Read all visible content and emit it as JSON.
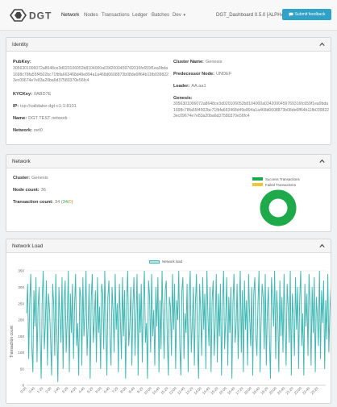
{
  "nav": {
    "brand": "DGT",
    "links": [
      "Network",
      "Nodes",
      "Transactions",
      "Ledger",
      "Batches",
      "Dev"
    ],
    "app_name": "DGT_Dashboard 0.5.0 [ALPHA]",
    "submit_label": "Submit feedback"
  },
  "identity": {
    "title": "Identity",
    "pubkey_label": "PubKey:",
    "pubkey": "3056301006072a8648ce3d020106052b8104000a0342000459769316fc659f1ea9bda1698c78fa55f4502bc71fbfa663468d49e894a1a468d0608873b08de6ff64b11fb0398223ec09674e7e83a20ba6d37580370e56fc4",
    "kyckey_label": "KYCKey:",
    "kyckey": "0ABD7E",
    "ip_label": "IP:",
    "ip": "tcp://validator-dgt-c1-1:8101",
    "name_label": "Name:",
    "name": "DGT TEST network",
    "network_label": "Network:",
    "network": "net0",
    "cluster_label": "Cluster Name:",
    "cluster": "Genesis",
    "predecessor_label": "Predecessor Node:",
    "predecessor": "UNDEF",
    "leader_label": "Leader:",
    "leader": "AA.aa1",
    "genesis_label": "Genesis:",
    "genesis": "3056301006072a8648ce3d020106052b8104000a0342000459769316fc659f1ea9bda1698c78fa55f4502bc71fbfa663468d49e894a1a468d0608873b08de6ff64b11fb0398223ec09674e7e83a20ba6d37580370e56fc4"
  },
  "network": {
    "title": "Network",
    "cluster_label": "Cluster:",
    "cluster": "Genesis",
    "node_count_label": "Node count:",
    "node_count": "36",
    "tx_count_label": "Transaction count:",
    "tx_count": "34",
    "tx_count_sub": "34",
    "tx_count_sep": "/",
    "tx_count_sub2": "0",
    "legend_success": "Success Transactions",
    "legend_failed": "Failed Transactions",
    "colors": {
      "success": "#1eaa4a",
      "failed": "#f2c438"
    },
    "donut": {
      "success": 34,
      "failed": 0
    }
  },
  "load": {
    "title": "Network Load",
    "legend": "Network load",
    "ylabel": "Transaction count",
    "line_color": "#41b8b3"
  },
  "chart_data": {
    "type": "line",
    "title": "",
    "xlabel": "",
    "ylabel": "Transaction count",
    "ylim": [
      0,
      350
    ],
    "yticks": [
      0,
      50,
      100,
      150,
      200,
      250,
      300,
      350
    ],
    "x": [
      "0:00",
      "0:05",
      "0:10",
      "0:15",
      "0:20",
      "0:25",
      "0:30",
      "0:35",
      "0:40",
      "0:45",
      "0:50",
      "0:55",
      "1:00",
      "1:05",
      "1:10",
      "1:15",
      "1:20",
      "1:25",
      "1:30",
      "1:35",
      "1:40",
      "1:45",
      "1:50",
      "1:55",
      "2:00",
      "2:05",
      "2:10",
      "2:15",
      "2:20",
      "2:25",
      "2:30",
      "2:35",
      "2:40",
      "2:45",
      "2:50",
      "2:55",
      "3:00",
      "3:05",
      "3:10",
      "3:15",
      "3:20",
      "3:25",
      "3:30",
      "3:35",
      "3:40",
      "3:45",
      "3:50",
      "3:55",
      "4:00",
      "4:05",
      "4:10",
      "4:15",
      "4:20",
      "4:25",
      "4:30",
      "4:35",
      "4:40",
      "4:45",
      "4:50",
      "4:55",
      "5:00",
      "5:05",
      "5:10",
      "5:15",
      "5:20",
      "5:25",
      "5:30",
      "5:35",
      "5:40",
      "5:45",
      "5:50",
      "5:55",
      "6:00",
      "6:05",
      "6:10",
      "6:15",
      "6:20",
      "6:25",
      "6:30",
      "6:35",
      "6:40",
      "6:45",
      "6:50",
      "6:55",
      "7:00",
      "7:05",
      "7:10",
      "7:15",
      "7:20",
      "7:25",
      "7:30",
      "7:35",
      "7:40",
      "7:45",
      "7:50",
      "7:55",
      "8:00",
      "8:05",
      "8:10",
      "8:15",
      "8:20",
      "8:25",
      "8:30",
      "8:35",
      "8:40",
      "8:45",
      "8:50",
      "8:55",
      "9:00",
      "9:05",
      "9:10",
      "9:15",
      "9:20",
      "9:25",
      "9:30",
      "9:35",
      "9:40",
      "9:45",
      "9:50",
      "9:55",
      "10:00",
      "10:05",
      "10:10",
      "10:15",
      "10:20",
      "10:25",
      "10:30",
      "10:35",
      "10:40",
      "10:45",
      "10:50",
      "10:55",
      "11:00",
      "11:05",
      "11:10",
      "11:15",
      "11:20",
      "11:25",
      "11:30",
      "11:35",
      "11:40",
      "11:45",
      "11:50",
      "11:55",
      "12:00",
      "12:05",
      "12:10",
      "12:15",
      "12:20",
      "12:25",
      "12:30",
      "12:35",
      "12:40",
      "12:45",
      "12:50",
      "12:55",
      "13:00",
      "13:05",
      "13:10",
      "13:15",
      "13:20",
      "13:25",
      "13:30",
      "13:35",
      "13:40",
      "13:45",
      "13:50",
      "13:55",
      "14:00",
      "14:05",
      "14:10",
      "14:15",
      "14:20",
      "14:25",
      "14:30",
      "14:35",
      "14:40",
      "14:45",
      "14:50",
      "14:55",
      "15:00",
      "15:05",
      "15:10",
      "15:15",
      "15:20",
      "15:25",
      "15:30",
      "15:35",
      "15:40",
      "15:45",
      "15:50",
      "15:55",
      "16:00",
      "16:05",
      "16:10",
      "16:15",
      "16:20",
      "16:25",
      "16:30",
      "16:35",
      "16:40",
      "16:45",
      "16:50",
      "16:55",
      "17:00",
      "17:05",
      "17:10",
      "17:15",
      "17:20",
      "17:25",
      "17:30",
      "17:35",
      "17:40",
      "17:45",
      "17:50",
      "17:55",
      "18:00",
      "18:05",
      "18:10",
      "18:15",
      "18:20",
      "18:25",
      "18:30",
      "18:35",
      "18:40",
      "18:45",
      "18:50",
      "18:55",
      "19:00",
      "19:05",
      "19:10",
      "19:15",
      "19:20",
      "19:25",
      "19:30",
      "19:35",
      "19:40",
      "19:45",
      "19:50",
      "19:55",
      "20:00",
      "20:05",
      "20:10",
      "20:15",
      "20:20",
      "20:25",
      "20:30",
      "20:35",
      "20:40",
      "20:45",
      "20:50",
      "20:55",
      "21:00",
      "21:05",
      "21:10",
      "21:15",
      "21:20",
      "21:25",
      "21:30",
      "21:35",
      "21:40",
      "21:45",
      "21:50",
      "21:55",
      "22:00",
      "22:05",
      "22:10",
      "22:15",
      "22:20",
      "22:25",
      "22:30",
      "22:35",
      "22:40",
      "22:45",
      "22:50",
      "22:55",
      "23:00",
      "23:05",
      "23:10",
      "23:15",
      "23:20",
      "23:25",
      "23:30",
      "23:35",
      "23:40",
      "23:45",
      "23:50",
      "23:55"
    ],
    "xticks": [
      "0:00",
      "0:40",
      "1:20",
      "2:00",
      "2:40",
      "3:20",
      "4:00",
      "4:40",
      "5:20",
      "6:00",
      "6:40",
      "7:20",
      "8:00",
      "8:40",
      "9:20",
      "10:00",
      "10:40",
      "11:20",
      "12:00",
      "12:40",
      "13:20",
      "14:00",
      "14:40",
      "15:20",
      "16:00",
      "16:40",
      "17:20",
      "18:00",
      "18:40",
      "19:20",
      "20:00",
      "20:40",
      "21:20",
      "22:00",
      "22:40",
      "23:20"
    ],
    "series": [
      {
        "name": "Network load",
        "values": [
          220,
          310,
          80,
          260,
          340,
          120,
          40,
          290,
          180,
          330,
          70,
          240,
          300,
          150,
          20,
          270,
          350,
          110,
          190,
          320,
          60,
          280,
          230,
          140,
          30,
          310,
          250,
          90,
          340,
          170,
          10,
          300,
          210,
          130,
          330,
          50,
          260,
          320,
          100,
          200,
          350,
          40,
          280,
          160,
          310,
          80,
          240,
          340,
          120,
          190,
          30,
          300,
          270,
          60,
          330,
          150,
          220,
          350,
          90,
          180,
          310,
          20,
          260,
          340,
          130,
          200,
          290,
          70,
          330,
          160,
          240,
          50,
          310,
          280,
          110,
          350,
          190,
          30,
          270,
          320,
          140,
          60,
          300,
          230,
          100,
          340,
          170,
          250,
          40,
          310,
          200,
          80,
          330,
          150,
          290,
          20,
          260,
          350,
          120,
          180,
          300,
          60,
          240,
          330,
          90,
          210,
          340,
          30,
          280,
          160,
          310,
          70,
          250,
          350,
          130,
          190,
          20,
          320,
          270,
          100,
          340,
          150,
          230,
          60,
          300,
          180,
          330,
          40,
          260,
          110,
          350,
          200,
          80,
          290,
          320,
          140,
          30,
          270,
          240,
          90,
          340,
          170,
          310,
          50,
          260,
          200,
          350,
          120,
          30,
          290,
          330,
          80,
          220,
          160,
          310,
          40,
          270,
          350,
          100,
          190,
          300,
          60,
          250,
          340,
          130,
          20,
          310,
          230,
          90,
          330,
          170,
          280,
          50,
          350,
          210,
          120,
          300,
          40,
          260,
          320,
          90,
          190,
          340,
          70,
          280,
          150,
          310,
          30,
          240,
          350,
          110,
          200,
          330,
          60,
          270,
          160,
          300,
          20,
          250,
          340,
          130,
          180,
          310,
          80,
          230,
          350,
          100,
          290,
          40,
          320,
          170,
          260,
          60,
          340,
          210,
          120,
          300,
          30,
          280,
          330,
          150,
          90,
          250,
          350,
          40,
          190,
          310,
          270,
          110,
          340,
          60,
          230,
          300,
          140,
          20,
          330,
          260,
          180,
          350,
          80,
          290,
          210,
          40,
          320,
          150,
          270,
          100,
          340,
          190,
          60,
          310,
          240,
          130,
          350,
          30,
          280,
          200,
          90,
          330,
          170,
          300,
          50,
          260,
          350,
          120,
          220,
          30,
          310,
          180,
          280,
          90,
          340,
          240,
          60,
          300,
          160,
          330,
          40,
          270,
          210,
          120,
          350,
          80,
          290,
          190,
          320,
          50,
          260,
          140,
          340,
          100,
          230,
          300,
          20,
          280,
          170,
          330,
          70,
          250,
          350,
          110,
          200
        ]
      }
    ]
  }
}
